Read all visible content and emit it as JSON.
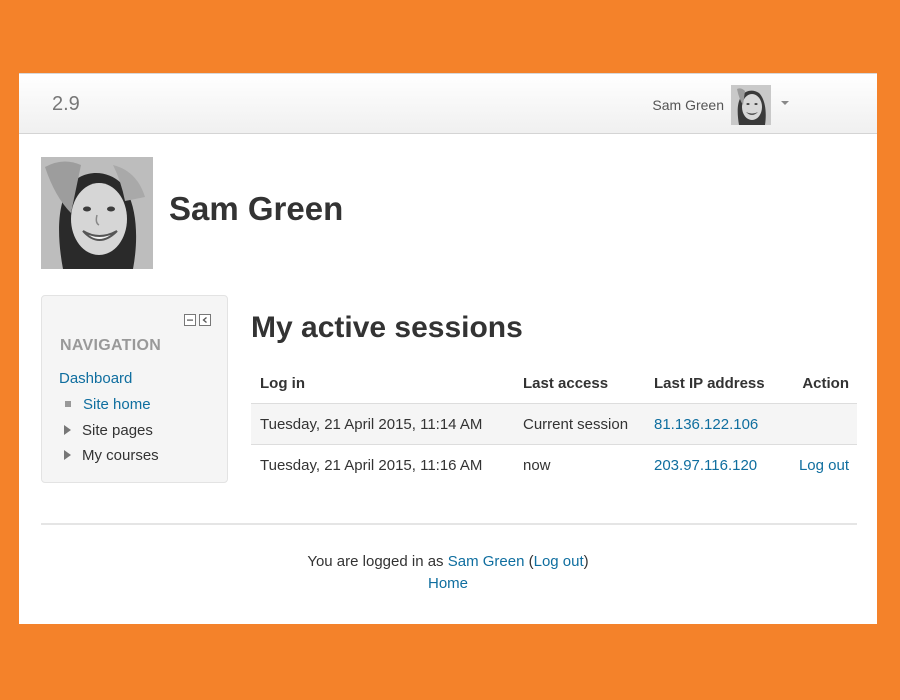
{
  "navbar": {
    "brand": "2.9",
    "user_name": "Sam Green"
  },
  "header": {
    "title": "Sam Green"
  },
  "navigation_block": {
    "title": "NAVIGATION",
    "dashboard": "Dashboard",
    "items": [
      {
        "label": "Site home",
        "type": "link"
      },
      {
        "label": "Site pages",
        "type": "collapsed"
      },
      {
        "label": "My courses",
        "type": "collapsed"
      }
    ]
  },
  "main": {
    "title": "My active sessions",
    "columns": [
      "Log in",
      "Last access",
      "Last IP address",
      "Action"
    ],
    "rows": [
      {
        "login": "Tuesday, 21 April 2015, 11:14 AM",
        "last_access": "Current session",
        "ip": "81.136.122.106",
        "action": ""
      },
      {
        "login": "Tuesday, 21 April 2015, 11:16 AM",
        "last_access": "now",
        "ip": "203.97.116.120",
        "action": "Log out"
      }
    ]
  },
  "footer": {
    "logged_in_prefix": "You are logged in as",
    "user_link": "Sam Green",
    "open_paren": " (",
    "logout_link": "Log out",
    "close_paren": ")",
    "home_link": "Home"
  },
  "colors": {
    "page_background": "#f4822a",
    "link": "#0f6e9f",
    "text": "#333333"
  }
}
